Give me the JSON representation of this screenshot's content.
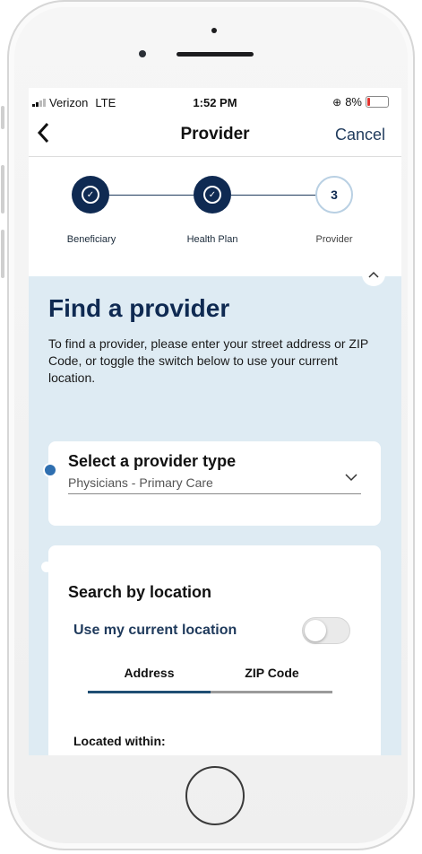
{
  "status_bar": {
    "carrier": "Verizon",
    "network": "LTE",
    "time": "1:52 PM",
    "battery": "8%"
  },
  "nav": {
    "back_icon": "chevron-left-icon",
    "title": "Provider",
    "cancel_label": "Cancel"
  },
  "stepper": {
    "steps": [
      {
        "label": "Beneficiary",
        "state": "done"
      },
      {
        "label": "Health Plan",
        "state": "done"
      },
      {
        "label": "Provider",
        "state": "current",
        "number": "3"
      }
    ]
  },
  "main": {
    "title": "Find a provider",
    "description": "To find a provider, please enter your street address or ZIP Code, or toggle the switch below to use your current location."
  },
  "provider_type": {
    "title": "Select a provider type",
    "value": "Physicians - Primary Care"
  },
  "location": {
    "title": "Search by location",
    "toggle_label": "Use my current location",
    "toggle_on": false,
    "tabs": [
      {
        "label": "Address",
        "active": true
      },
      {
        "label": "ZIP Code",
        "active": false
      }
    ],
    "within_label": "Located within:"
  },
  "colors": {
    "primary": "#0f2a52",
    "accent": "#1f3a5c",
    "background": "#deebf3",
    "check_dot": "#2f6fb0"
  }
}
